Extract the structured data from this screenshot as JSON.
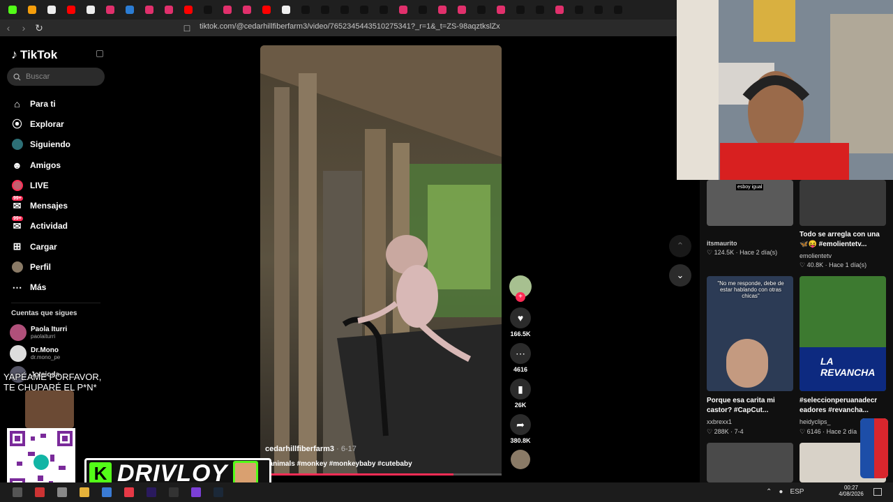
{
  "browser": {
    "url": "tiktok.com/@cedarhillfiberfarm3/video/7652345443510275341?_r=1&_t=ZS-98aqztkslZx",
    "tab_colors": [
      "#53fc18",
      "#f59e0b",
      "#eeeeee",
      "#ff0000",
      "#eeeeee",
      "#e1306c",
      "#2b7cd3",
      "#e1306c",
      "#e1306c",
      "#ff0000",
      "#111111",
      "#e1306c",
      "#e1306c",
      "#ff0000",
      "#eeeeee",
      "#111111",
      "#111111",
      "#111111",
      "#111111",
      "#111111",
      "#e1306c",
      "#111111",
      "#e1306c",
      "#e1306c",
      "#111111",
      "#e1306c",
      "#111111",
      "#111111",
      "#e1306c",
      "#111111",
      "#111111",
      "#111111"
    ]
  },
  "sidebar": {
    "logo": "TikTok",
    "search_placeholder": "Buscar",
    "nav": [
      {
        "label": "Para ti",
        "icon": "home-icon"
      },
      {
        "label": "Explorar",
        "icon": "compass-icon"
      },
      {
        "label": "Siguiendo",
        "icon": "following-icon"
      },
      {
        "label": "Amigos",
        "icon": "friends-icon"
      },
      {
        "label": "LIVE",
        "icon": "live-icon"
      },
      {
        "label": "Mensajes",
        "icon": "messages-icon",
        "badge": "99+"
      },
      {
        "label": "Actividad",
        "icon": "activity-icon",
        "badge": "99+"
      },
      {
        "label": "Cargar",
        "icon": "upload-icon"
      },
      {
        "label": "Perfil",
        "icon": "profile-icon"
      },
      {
        "label": "Más",
        "icon": "more-icon"
      }
    ],
    "following_title": "Cuentas que sigues",
    "following": [
      {
        "name": "Paola Iturri",
        "handle": "paolaiturri"
      },
      {
        "name": "Dr.Mono",
        "handle": "dr.mono_pe"
      },
      {
        "name": "Jotaioda",
        "handle": ""
      }
    ]
  },
  "video": {
    "user": "cedarhillfiberfarm3",
    "date": "· 6-17",
    "tags": "#animals #monkey #monkeybaby #cutebaby",
    "progress": 0.8,
    "likes": "166.5K",
    "comments": "4616",
    "saves": "26K",
    "shares": "380.8K"
  },
  "recommendations": [
    {
      "caption": "esboy igual",
      "user": "itsmaurito",
      "views": "124.5K",
      "age": "Hace 2 día(s)",
      "title": ""
    },
    {
      "caption": "",
      "user": "emolientetv",
      "views": "40.8K",
      "age": "Hace 1 día(s)",
      "title": "Todo se arregla con una 🦋😝 #emolientetv..."
    },
    {
      "caption": "\"No me responde, debe de estar hablando con otras chicas\"",
      "user": "xxbrexx1",
      "views": "288K",
      "age": "7-4",
      "title": "Porque esa carita mi castor? #CapCut..."
    },
    {
      "caption": "LA REVANCHA",
      "user": "heidyclips_",
      "views": "6146",
      "age": "Hace 2 día",
      "title": "#seleccionperuanadecr eadores #revancha..."
    }
  ],
  "overlay": {
    "alert_text": "YAPÉAME PORFAVOR, TE CHUPARÉ  EL P*N*",
    "brand_name": "DRIVLOY",
    "brand_k": "K"
  },
  "taskbar": {
    "lang": "ESP",
    "time": "00:27",
    "date": "4/08/2026"
  }
}
